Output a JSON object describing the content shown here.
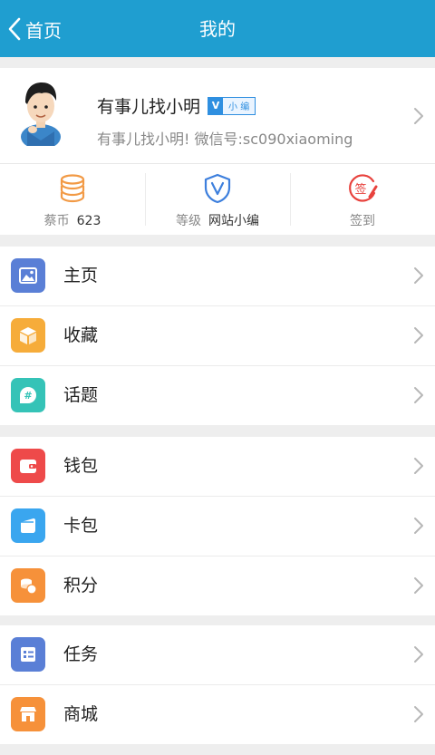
{
  "header": {
    "back_label": "首页",
    "title": "我的"
  },
  "profile": {
    "nickname": "有事儿找小明",
    "badge_v": "V",
    "badge_text": "小 编",
    "signature": "有事儿找小明! 微信号:sc090xiaoming"
  },
  "stats": [
    {
      "label": "蔡币",
      "value": "623",
      "icon": "coins-stack-icon",
      "color": "#f29a45"
    },
    {
      "label": "等级",
      "value": "网站小编",
      "icon": "shield-v-icon",
      "color": "#3d7fdd"
    },
    {
      "label": "签到",
      "value": "",
      "icon": "sign-in-stamp-icon",
      "color": "#e8423d"
    }
  ],
  "menu_groups": [
    [
      {
        "label": "主页",
        "icon": "homepage-picture-icon",
        "color": "#5a7fd6"
      },
      {
        "label": "收藏",
        "icon": "favorites-box-icon",
        "color": "#f6ac3a"
      },
      {
        "label": "话题",
        "icon": "topic-hash-icon",
        "color": "#35c3b7"
      }
    ],
    [
      {
        "label": "钱包",
        "icon": "wallet-icon",
        "color": "#ee4a4a"
      },
      {
        "label": "卡包",
        "icon": "card-holder-icon",
        "color": "#3aa6ef"
      },
      {
        "label": "积分",
        "icon": "points-coins-icon",
        "color": "#f6913a"
      }
    ],
    [
      {
        "label": "任务",
        "icon": "task-list-icon",
        "color": "#5a7fd6"
      },
      {
        "label": "商城",
        "icon": "store-icon",
        "color": "#f6913a"
      }
    ]
  ]
}
